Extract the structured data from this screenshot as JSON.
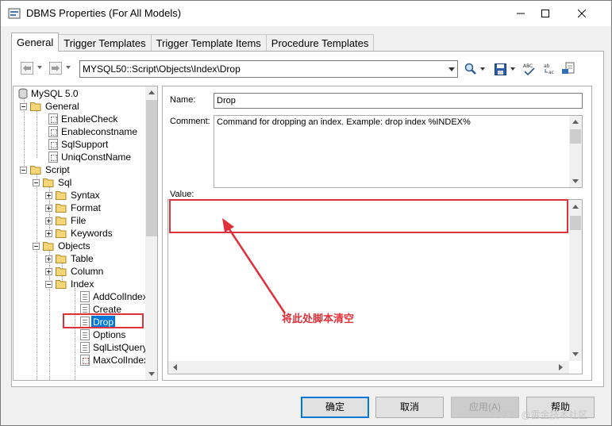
{
  "window": {
    "title": "DBMS Properties (For All Models)"
  },
  "tabs": [
    {
      "label": "General"
    },
    {
      "label": "Trigger Templates"
    },
    {
      "label": "Trigger Template Items"
    },
    {
      "label": "Procedure Templates"
    }
  ],
  "toolbar": {
    "path": "MYSQL50::Script\\Objects\\Index\\Drop"
  },
  "tree": {
    "items": [
      {
        "label": "MySQL 5.0"
      },
      {
        "label": "General"
      },
      {
        "label": "EnableCheck"
      },
      {
        "label": "Enableconstname"
      },
      {
        "label": "SqlSupport"
      },
      {
        "label": "UniqConstName"
      },
      {
        "label": "Script"
      },
      {
        "label": "Sql"
      },
      {
        "label": "Syntax"
      },
      {
        "label": "Format"
      },
      {
        "label": "File"
      },
      {
        "label": "Keywords"
      },
      {
        "label": "Objects"
      },
      {
        "label": "Table"
      },
      {
        "label": "Column"
      },
      {
        "label": "Index"
      },
      {
        "label": "AddColIndex"
      },
      {
        "label": "Create"
      },
      {
        "label": "Drop"
      },
      {
        "label": "Options"
      },
      {
        "label": "SqlListQuery"
      },
      {
        "label": "MaxColIndex"
      }
    ]
  },
  "details": {
    "name_label": "Name:",
    "name_value": "Drop",
    "comment_label": "Comment:",
    "comment_value": "Command for dropping an index. Example: drop index %INDEX%",
    "value_label": "Value:",
    "value_value": ""
  },
  "annotation": {
    "text": "将此处脚本清空",
    "color": "#e0303a"
  },
  "buttons": {
    "ok": "确定",
    "cancel": "取消",
    "apply": "应用(A)",
    "help": "帮助"
  },
  "watermark": "CSDN @雷金技术社区"
}
